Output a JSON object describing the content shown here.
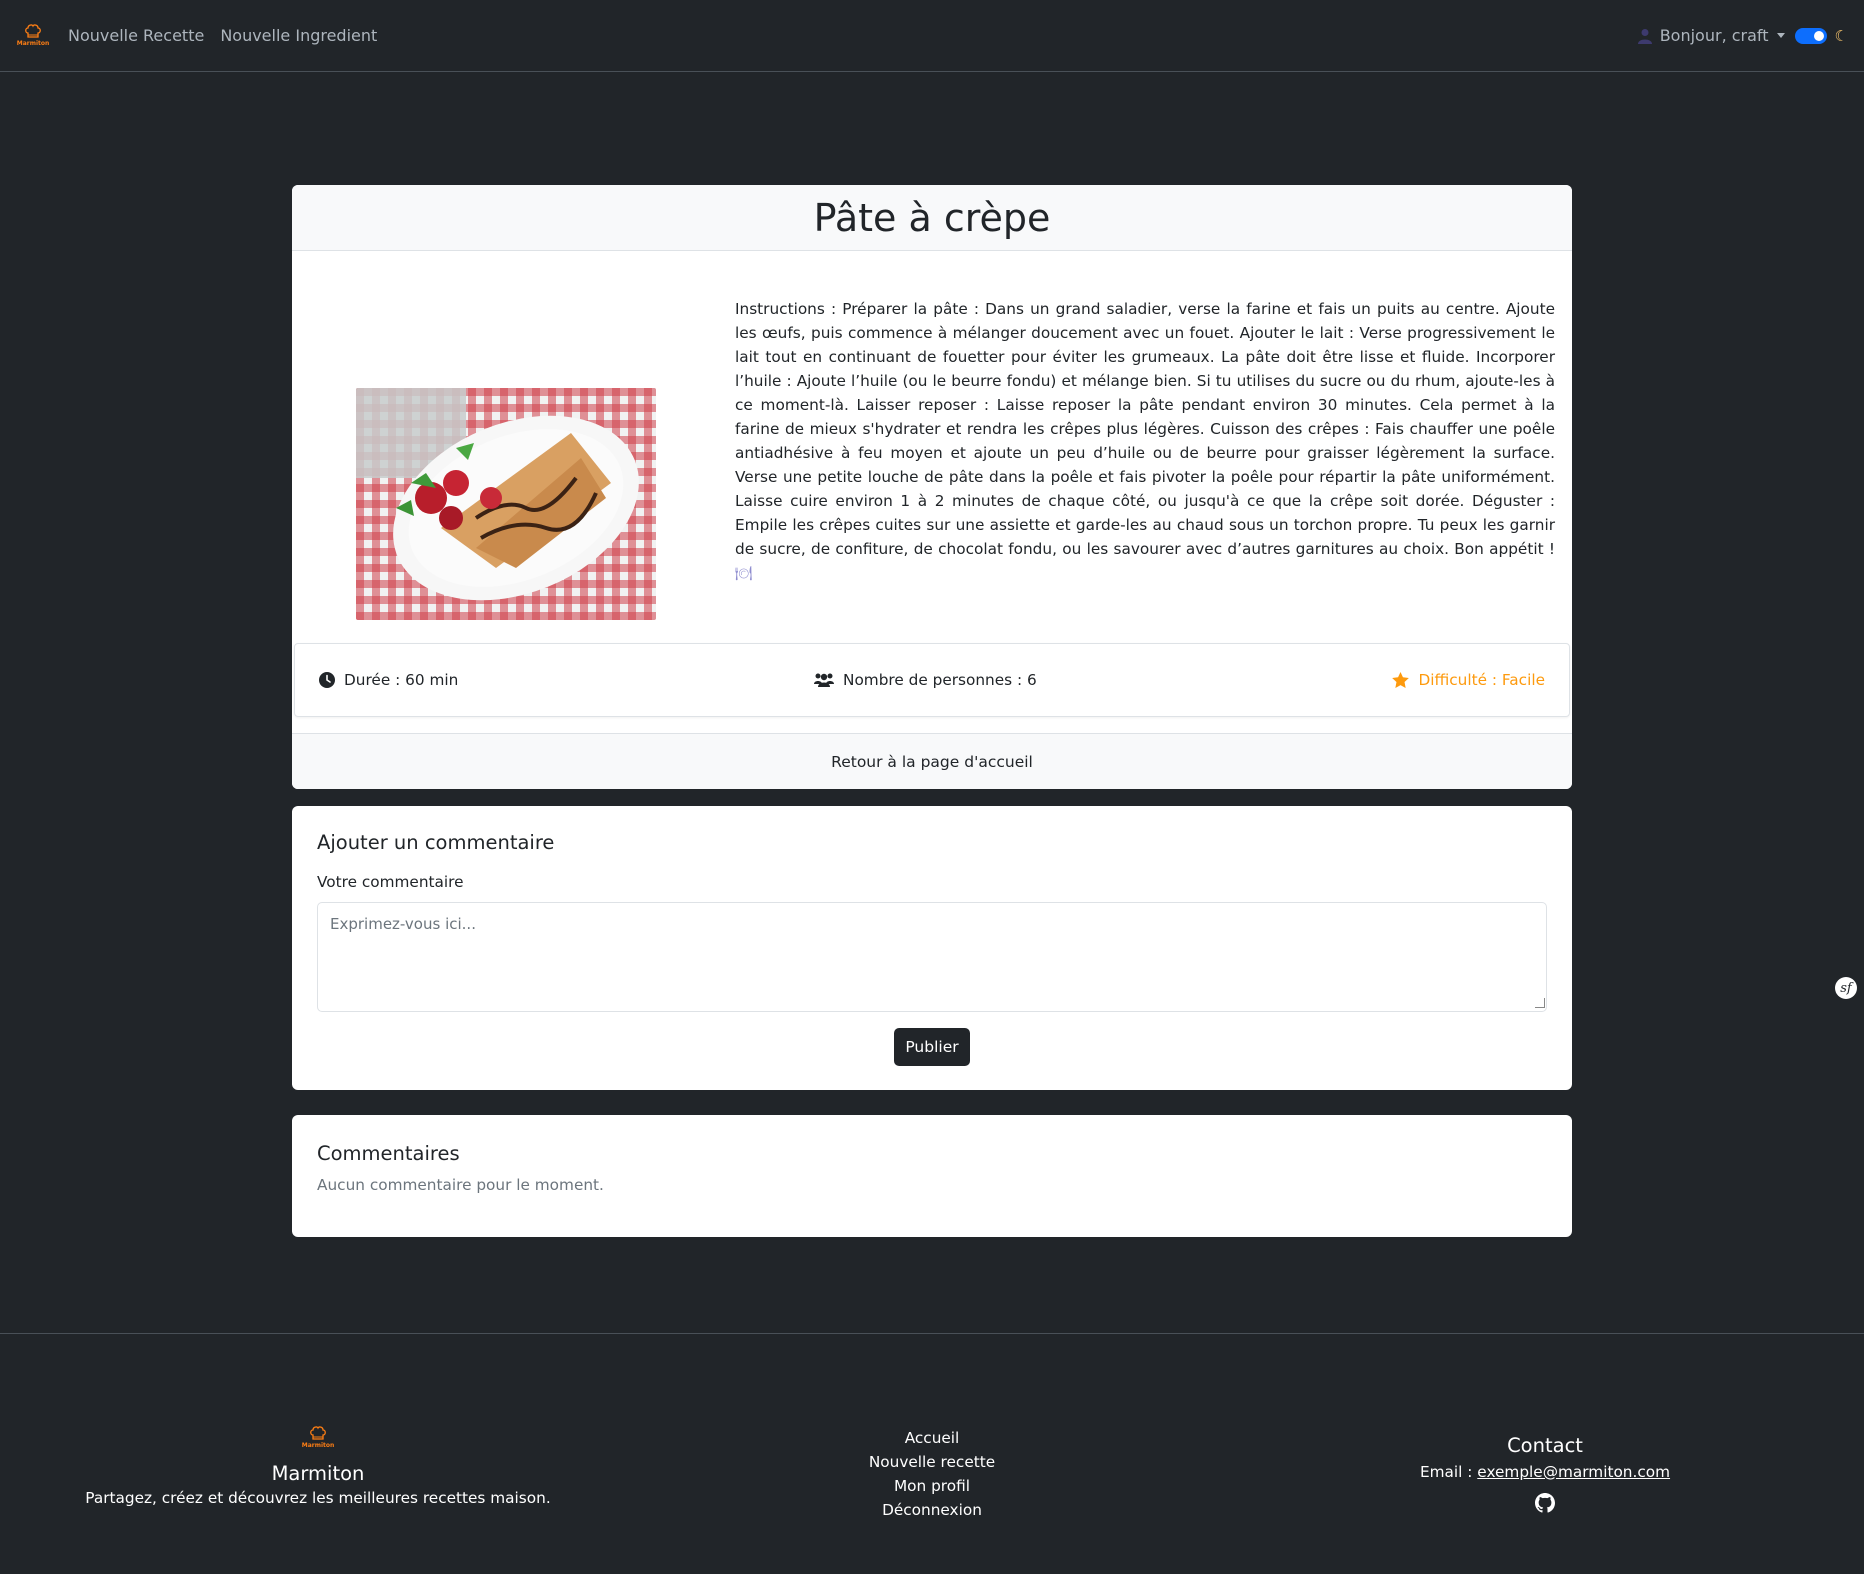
{
  "navbar": {
    "brand_text": "Marmiton",
    "links": [
      "Nouvelle Recette",
      "Nouvelle Ingredient"
    ],
    "user_greeting": "Bonjour, craft"
  },
  "recipe": {
    "title": "Pâte à crèpe",
    "instructions": "Instructions : Préparer la pâte : Dans un grand saladier, verse la farine et fais un puits au centre. Ajoute les œufs, puis commence à mélanger doucement avec un fouet. Ajouter le lait : Verse progressivement le lait tout en continuant de fouetter pour éviter les grumeaux. La pâte doit être lisse et fluide. Incorporer l’huile : Ajoute l’huile (ou le beurre fondu) et mélange bien. Si tu utilises du sucre ou du rhum, ajoute-les à ce moment-là. Laisser reposer : Laisse reposer la pâte pendant environ 30 minutes. Cela permet à la farine de mieux s'hydrater et rendra les crêpes plus légères. Cuisson des crêpes : Fais chauffer une poêle antiadhésive à feu moyen et ajoute un peu d’huile ou de beurre pour graisser légèrement la surface. Verse une petite louche de pâte dans la poêle et fais pivoter la poêle pour répartir la pâte uniformément. Laisse cuire environ 1 à 2 minutes de chaque côté, ou jusqu'à ce que la crêpe soit dorée. Déguster : Empile les crêpes cuites sur une assiette et garde-les au chaud sous un torchon propre. Tu peux les garnir de sucre, de confiture, de chocolat fondu, ou les savourer avec d’autres garnitures au choix. Bon appétit !",
    "duration": "Durée : 60 min",
    "servings": "Nombre de personnes : 6",
    "difficulty": "Difficulté : Facile",
    "back_link": "Retour à la page d'accueil"
  },
  "comment_form": {
    "title": "Ajouter un commentaire",
    "label": "Votre commentaire",
    "placeholder": "Exprimez-vous ici...",
    "submit_label": "Publier"
  },
  "comments": {
    "title": "Commentaires",
    "empty_text": "Aucun commentaire pour le moment."
  },
  "footer": {
    "brand_text": "Marmiton",
    "brand_name": "Marmiton",
    "tagline": "Partagez, créez et découvrez les meilleures recettes maison.",
    "links": [
      "Accueil",
      "Nouvelle recette",
      "Mon profil",
      "Déconnexion"
    ],
    "contact_title": "Contact",
    "email_label": "Email :",
    "email": "exemple@marmiton.com"
  },
  "colors": {
    "background": "#212529",
    "accent_orange": "#fd7e14",
    "difficulty": "#fd9a0e",
    "toggle": "#0d6efd"
  }
}
